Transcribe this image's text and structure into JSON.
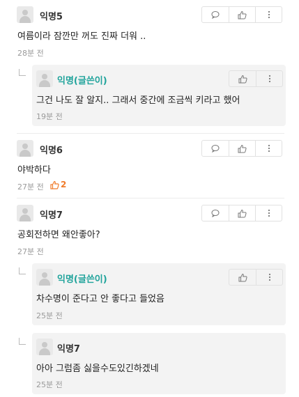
{
  "comments": [
    {
      "author": "익명5",
      "text": "여름이라 잠깐만 꺼도 진짜 더워 ..",
      "time": "28분 전"
    },
    {
      "author": "익명(글쓴이)",
      "text": "그건 나도 잘 알지.. 그래서 중간에 조금씩 키라고 했어",
      "time": "19분 전",
      "is_reply": true
    },
    {
      "author": "익명6",
      "text": "야박하다",
      "time": "27분 전",
      "likes": "2"
    },
    {
      "author": "익명7",
      "text": "공회전하면 왜안좋아?",
      "time": "27분 전"
    },
    {
      "author": "익명(글쓴이)",
      "text": "차수명이 준다고 안 좋다고 들었음",
      "time": "25분 전",
      "is_reply": true
    },
    {
      "author": "익명7",
      "text": "아아 그럼좀 싫을수도있긴하겠네",
      "time": "25분 전",
      "is_reply": true
    }
  ],
  "icons": {
    "comment": "speech-bubble-icon",
    "like": "thumbs-up-icon",
    "more": "more-vertical-icon"
  },
  "colors": {
    "op_author": "#1fa39b",
    "like_count": "#f07b2a",
    "reply_bg": "#f3f3f3"
  }
}
